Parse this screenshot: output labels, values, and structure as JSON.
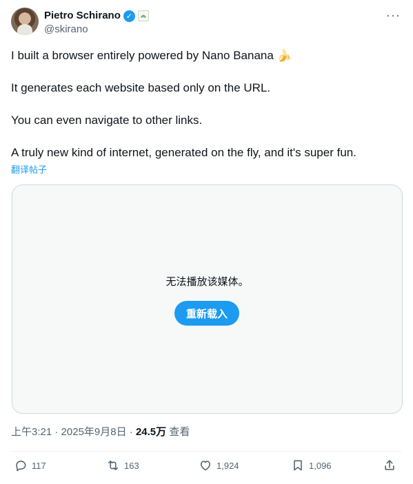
{
  "author": {
    "name": "Pietro Schirano",
    "handle": "@skirano",
    "verified_glyph": "✓",
    "affiliate_glyph": "❧"
  },
  "more_glyph": "···",
  "tweet": {
    "paragraphs": [
      "I built a browser entirely powered by Nano Banana 🍌",
      "It generates each website based only on the URL.",
      "You can even navigate to other links.",
      "A truly new kind of internet, generated on the fly, and it's super fun."
    ],
    "translate_label": "翻译帖子"
  },
  "media": {
    "message": "无法播放该媒体。",
    "reload_label": "重新载入"
  },
  "meta": {
    "time": "上午3:21",
    "date": "2025年9月8日",
    "views_count": "24.5万",
    "views_label": "查看",
    "separator": " · "
  },
  "actions": {
    "replies": "117",
    "reposts": "163",
    "likes": "1,924",
    "bookmarks": "1,096"
  },
  "colors": {
    "accent": "#1d9bf0",
    "secondary_text": "#536471"
  }
}
